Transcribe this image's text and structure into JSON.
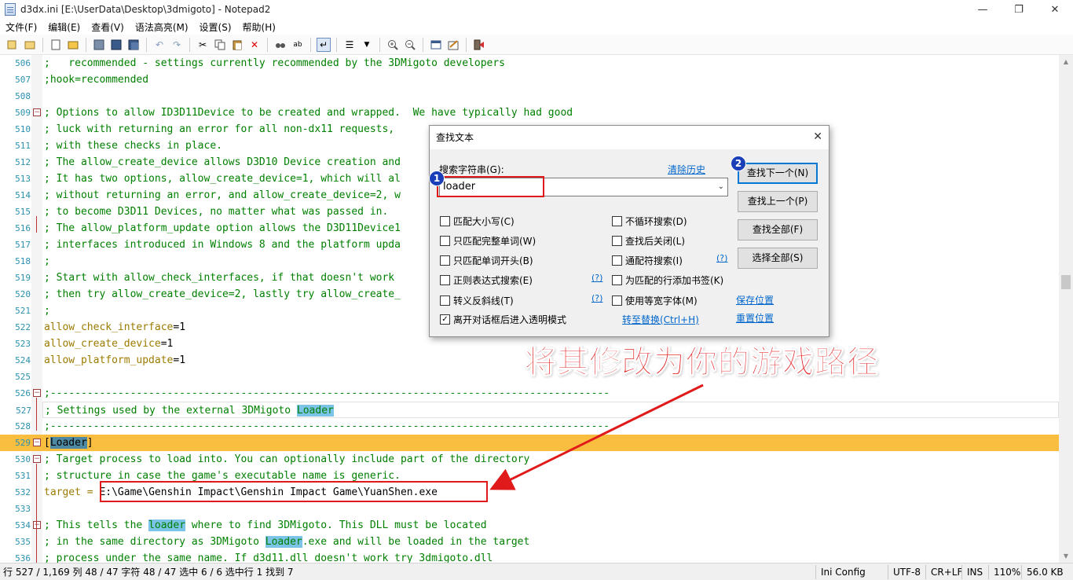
{
  "window": {
    "title": "d3dx.ini [E:\\UserData\\Desktop\\3dmigoto] - Notepad2",
    "minimize": "—",
    "maximize": "❐",
    "close": "✕"
  },
  "menu": [
    "文件(F)",
    "编辑(E)",
    "查看(V)",
    "语法高亮(M)",
    "设置(S)",
    "帮助(H)"
  ],
  "toolbar_icons": [
    "new-icon",
    "open-icon",
    "browse-icon",
    "save-icon",
    "save-as-icon",
    "save-copy-icon",
    "undo-icon",
    "redo-icon",
    "cut-icon",
    "copy-icon",
    "paste-icon",
    "delete-icon",
    "find-icon",
    "replace-icon",
    "wordwrap-icon",
    "settings-icon",
    "zoom-in-icon",
    "zoom-out-icon",
    "scheme-icon",
    "customize-icon",
    "exit-icon"
  ],
  "editor": {
    "lines": [
      {
        "n": "506",
        "segs": [
          {
            "t": ";   recommended - settings currently recommended by the 3DMigoto developers",
            "c": "comment"
          }
        ]
      },
      {
        "n": "507",
        "segs": [
          {
            "t": ";hook=recommended",
            "c": "comment"
          }
        ]
      },
      {
        "n": "508",
        "segs": []
      },
      {
        "n": "509",
        "segs": [
          {
            "t": "; Options to allow ID3D11Device to be created and wrapped.  We have typically had good",
            "c": "comment"
          }
        ]
      },
      {
        "n": "510",
        "segs": [
          {
            "t": "; luck with returning an error for all non-dx11 requests,",
            "c": "comment"
          }
        ]
      },
      {
        "n": "511",
        "segs": [
          {
            "t": "; with these checks in place.",
            "c": "comment"
          }
        ]
      },
      {
        "n": "512",
        "segs": [
          {
            "t": "; The allow_create_device allows D3D10 Device creation and",
            "c": "comment"
          }
        ]
      },
      {
        "n": "513",
        "segs": [
          {
            "t": "; It has two options, allow_create_device=1, which will al",
            "c": "comment"
          }
        ]
      },
      {
        "n": "514",
        "segs": [
          {
            "t": "; without returning an error, and allow_create_device=2, w",
            "c": "comment"
          }
        ]
      },
      {
        "n": "515",
        "segs": [
          {
            "t": "; to become D3D11 Devices, no matter what was passed in.",
            "c": "comment"
          }
        ]
      },
      {
        "n": "516",
        "segs": [
          {
            "t": "; The allow_platform_update option allows the D3D11Device1",
            "c": "comment"
          }
        ]
      },
      {
        "n": "517",
        "segs": [
          {
            "t": "; interfaces introduced in Windows 8 and the platform upda",
            "c": "comment"
          }
        ]
      },
      {
        "n": "518",
        "segs": [
          {
            "t": ";",
            "c": "comment"
          }
        ]
      },
      {
        "n": "519",
        "segs": [
          {
            "t": "; Start with allow_check_interfaces, if that doesn't work",
            "c": "comment"
          }
        ]
      },
      {
        "n": "520",
        "segs": [
          {
            "t": "; then try allow_create_device=2, lastly try allow_create_",
            "c": "comment"
          }
        ]
      },
      {
        "n": "521",
        "segs": [
          {
            "t": ";",
            "c": "comment"
          }
        ]
      },
      {
        "n": "522",
        "segs": [
          {
            "t": "allow_check_interface",
            "c": "key"
          },
          {
            "t": "=1",
            "c": "val"
          }
        ]
      },
      {
        "n": "523",
        "segs": [
          {
            "t": "allow_create_device",
            "c": "key"
          },
          {
            "t": "=1",
            "c": "val"
          }
        ]
      },
      {
        "n": "524",
        "segs": [
          {
            "t": "allow_platform_update",
            "c": "key"
          },
          {
            "t": "=1",
            "c": "val"
          }
        ]
      },
      {
        "n": "525",
        "segs": []
      },
      {
        "n": "526",
        "segs": [
          {
            "t": ";-------------------------------------------------------------------------------------------",
            "c": "comment"
          }
        ]
      },
      {
        "n": "527",
        "segs": [
          {
            "t": "; Settings used by the external 3DMigoto ",
            "c": "comment"
          },
          {
            "t": "Loader",
            "c": "comment hl"
          }
        ]
      },
      {
        "n": "528",
        "segs": [
          {
            "t": ";-------------------------------------------------------------------------------------------",
            "c": "comment"
          }
        ]
      },
      {
        "n": "529",
        "segs": [
          {
            "t": "[",
            "c": "sect"
          },
          {
            "t": "Loader",
            "c": "sect hlsect"
          },
          {
            "t": "]",
            "c": "sect"
          }
        ],
        "highlight": true
      },
      {
        "n": "530",
        "segs": [
          {
            "t": "; Target process to load into. You can optionally include part of the directory",
            "c": "comment"
          }
        ]
      },
      {
        "n": "531",
        "segs": [
          {
            "t": "; structure in case the game's executable name is generic.",
            "c": "comment"
          }
        ]
      },
      {
        "n": "532",
        "segs": [
          {
            "t": "target = ",
            "c": "key"
          },
          {
            "t": "E:\\Game\\Genshin Impact\\Genshin Impact Game\\YuanShen.exe",
            "c": "val"
          }
        ]
      },
      {
        "n": "533",
        "segs": []
      },
      {
        "n": "534",
        "segs": [
          {
            "t": "; This tells the ",
            "c": "comment"
          },
          {
            "t": "loader",
            "c": "comment hl"
          },
          {
            "t": " where to find 3DMigoto. This DLL must be located",
            "c": "comment"
          }
        ]
      },
      {
        "n": "535",
        "segs": [
          {
            "t": "; in the same directory as 3DMigoto ",
            "c": "comment"
          },
          {
            "t": "Loader",
            "c": "comment hl"
          },
          {
            "t": ".exe and will be loaded in the target",
            "c": "comment"
          }
        ]
      },
      {
        "n": "536",
        "segs": [
          {
            "t": "; process under the same name. If d3d11.dll doesn't work try 3dmigoto.dll",
            "c": "comment"
          }
        ]
      }
    ]
  },
  "dialog": {
    "title": "查找文本",
    "search_label": "搜索字符串(G):",
    "clear_history": "清除历史",
    "search_value": "loader",
    "buttons": {
      "find_next": "查找下一个(N)",
      "find_prev": "查找上一个(P)",
      "find_all": "查找全部(F)",
      "select_all": "选择全部(S)"
    },
    "checkboxes_left": [
      {
        "label": "匹配大小写(C)",
        "checked": false
      },
      {
        "label": "只匹配完整单词(W)",
        "checked": false
      },
      {
        "label": "只匹配单词开头(B)",
        "checked": false
      },
      {
        "label": "正则表达式搜索(E)",
        "checked": false
      },
      {
        "label": "转义反斜线(T)",
        "checked": false
      },
      {
        "label": "离开对话框后进入透明模式",
        "checked": true
      }
    ],
    "checkboxes_right": [
      {
        "label": "不循环搜索(D)",
        "checked": false
      },
      {
        "label": "查找后关闭(L)",
        "checked": false
      },
      {
        "label": "通配符搜索(I)",
        "checked": false
      },
      {
        "label": "为匹配的行添加书签(K)",
        "checked": false
      },
      {
        "label": "使用等宽字体(M)",
        "checked": false
      }
    ],
    "help_mark": "(?)",
    "save_position": "保存位置",
    "reset_position": "重置位置",
    "goto_replace": "转至替换(Ctrl+H)"
  },
  "annotations": {
    "badge1": "1",
    "badge2": "2",
    "caption": "将其修改为你的游戏路径"
  },
  "statusbar": {
    "position": "行 527 / 1,169  列 48 / 47  字符 48 / 47  选中 6 / 6  选中行 1  找到 7",
    "lexer": "Ini Config File",
    "encoding": "UTF-8",
    "eol": "CR+LF",
    "ins": "INS",
    "zoom": "110%",
    "size": "56.0 KB"
  },
  "colors": {
    "highlight_line": "#f9bd3f",
    "comment": "#008000",
    "key": "#9b7b00",
    "annotation_red": "#e01a1a",
    "badge_blue": "#1a3fb8"
  }
}
